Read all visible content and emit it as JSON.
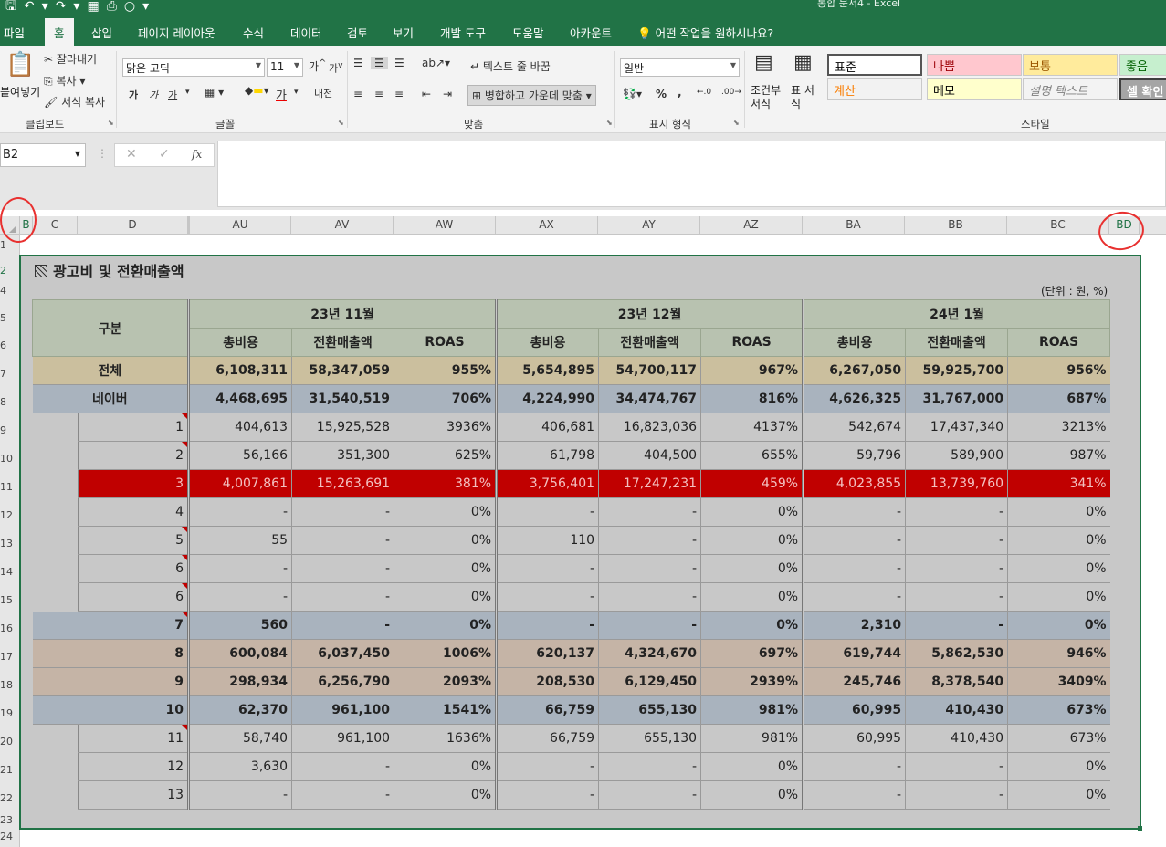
{
  "app": {
    "title": "통합 문서4 - Excel",
    "qat_icons": [
      "save-icon",
      "undo-icon",
      "redo-icon",
      "form-icon",
      "print-preview-icon",
      "circle-icon",
      "customize-icon"
    ]
  },
  "tabs": [
    "파일",
    "홈",
    "삽입",
    "페이지 레이아웃",
    "수식",
    "데이터",
    "검토",
    "보기",
    "개발 도구",
    "도움말",
    "아카운트"
  ],
  "tell_me": "어떤 작업을 원하시나요?",
  "ribbon": {
    "clipboard": {
      "paste": "붙여넣기",
      "cut": "잘라내기",
      "copy": "복사",
      "format_painter": "서식 복사",
      "label": "클립보드"
    },
    "font": {
      "name": "맑은 고딕",
      "size": "11",
      "label": "글꼴",
      "grow": "가",
      "shrink": "가",
      "bold": "가",
      "italic": "가",
      "underline": "가",
      "font_color_char": "가",
      "phonetic": "내천"
    },
    "alignment": {
      "wrap": "텍스트 줄 바꿈",
      "merge": "병합하고 가운데 맞춤",
      "label": "맞춤"
    },
    "number": {
      "format": "일반",
      "label": "표시 형식",
      "percent": "%",
      "comma": ","
    },
    "styles": {
      "cond": "조건부 서식",
      "table": "표 서식",
      "label": "스타일",
      "cells": [
        {
          "text": "표준",
          "bg": "#ffffff",
          "color": "#000000"
        },
        {
          "text": "나쁨",
          "bg": "#ffc7ce",
          "color": "#9c0006"
        },
        {
          "text": "보통",
          "bg": "#ffeb9c",
          "color": "#9c5700"
        },
        {
          "text": "좋음",
          "bg": "#c6efce",
          "color": "#006100"
        },
        {
          "text": "계산",
          "bg": "#f2f2f2",
          "color": "#fa7d00"
        },
        {
          "text": "메모",
          "bg": "#ffffcc",
          "color": "#000000"
        },
        {
          "text": "설명 텍스트",
          "bg": "#f3f3f3",
          "color": "#7f7f7f"
        },
        {
          "text": "셀 확인",
          "bg": "#a5a5a5",
          "color": "#ffffff"
        }
      ]
    }
  },
  "namebox": "B2",
  "fx": "fx",
  "columns": [
    "B",
    "C",
    "D",
    "AU",
    "AV",
    "AW",
    "AX",
    "AY",
    "AZ",
    "BA",
    "BB",
    "BC",
    "BD"
  ],
  "rows": [
    "1",
    "2",
    "4",
    "5",
    "6",
    "7",
    "8",
    "9",
    "10",
    "11",
    "12",
    "13",
    "14",
    "15",
    "16",
    "17",
    "18",
    "19",
    "20",
    "21",
    "22",
    "23",
    "24"
  ],
  "sheet": {
    "title": "광고비 및 전환매출액",
    "unit": "(단위 : 원, %)",
    "header_label": "구분",
    "months": [
      "23년 11월",
      "23년 12월",
      "24년 1월"
    ],
    "metrics": [
      "총비용",
      "전환매출액",
      "ROAS"
    ],
    "rows": [
      {
        "label": "전체",
        "values": [
          "6,108,311",
          "58,347,059",
          "955%",
          "5,654,895",
          "54,700,117",
          "967%",
          "6,267,050",
          "59,925,700",
          "956%"
        ]
      },
      {
        "label": "네이버",
        "values": [
          "4,468,695",
          "31,540,519",
          "706%",
          "4,224,990",
          "34,474,767",
          "816%",
          "4,626,325",
          "31,767,000",
          "687%"
        ]
      },
      {
        "label": "1",
        "values": [
          "404,613",
          "15,925,528",
          "3936%",
          "406,681",
          "16,823,036",
          "4137%",
          "542,674",
          "17,437,340",
          "3213%"
        ]
      },
      {
        "label": "2",
        "values": [
          "56,166",
          "351,300",
          "625%",
          "61,798",
          "404,500",
          "655%",
          "59,796",
          "589,900",
          "987%"
        ]
      },
      {
        "label": "3",
        "values": [
          "4,007,861",
          "15,263,691",
          "381%",
          "3,756,401",
          "17,247,231",
          "459%",
          "4,023,855",
          "13,739,760",
          "341%"
        ]
      },
      {
        "label": "4",
        "values": [
          "-",
          "-",
          "0%",
          "-",
          "-",
          "0%",
          "-",
          "-",
          "0%"
        ]
      },
      {
        "label": "5",
        "values": [
          "55",
          "-",
          "0%",
          "110",
          "-",
          "0%",
          "-",
          "-",
          "0%"
        ]
      },
      {
        "label": "6",
        "values": [
          "-",
          "-",
          "0%",
          "-",
          "-",
          "0%",
          "-",
          "-",
          "0%"
        ]
      },
      {
        "label": "6",
        "values": [
          "-",
          "-",
          "0%",
          "-",
          "-",
          "0%",
          "-",
          "-",
          "0%"
        ]
      },
      {
        "label": "7",
        "values": [
          "560",
          "-",
          "0%",
          "-",
          "-",
          "0%",
          "2,310",
          "-",
          "0%"
        ]
      },
      {
        "label": "8",
        "values": [
          "600,084",
          "6,037,450",
          "1006%",
          "620,137",
          "4,324,670",
          "697%",
          "619,744",
          "5,862,530",
          "946%"
        ]
      },
      {
        "label": "9",
        "values": [
          "298,934",
          "6,256,790",
          "2093%",
          "208,530",
          "6,129,450",
          "2939%",
          "245,746",
          "8,378,540",
          "3409%"
        ]
      },
      {
        "label": "10",
        "values": [
          "62,370",
          "961,100",
          "1541%",
          "66,759",
          "655,130",
          "981%",
          "60,995",
          "410,430",
          "673%"
        ]
      },
      {
        "label": "11",
        "values": [
          "58,740",
          "961,100",
          "1636%",
          "66,759",
          "655,130",
          "981%",
          "60,995",
          "410,430",
          "673%"
        ]
      },
      {
        "label": "12",
        "values": [
          "3,630",
          "-",
          "0%",
          "-",
          "-",
          "0%",
          "-",
          "-",
          "0%"
        ]
      },
      {
        "label": "13",
        "values": [
          "-",
          "-",
          "0%",
          "-",
          "-",
          "0%",
          "-",
          "-",
          "0%"
        ]
      }
    ]
  }
}
